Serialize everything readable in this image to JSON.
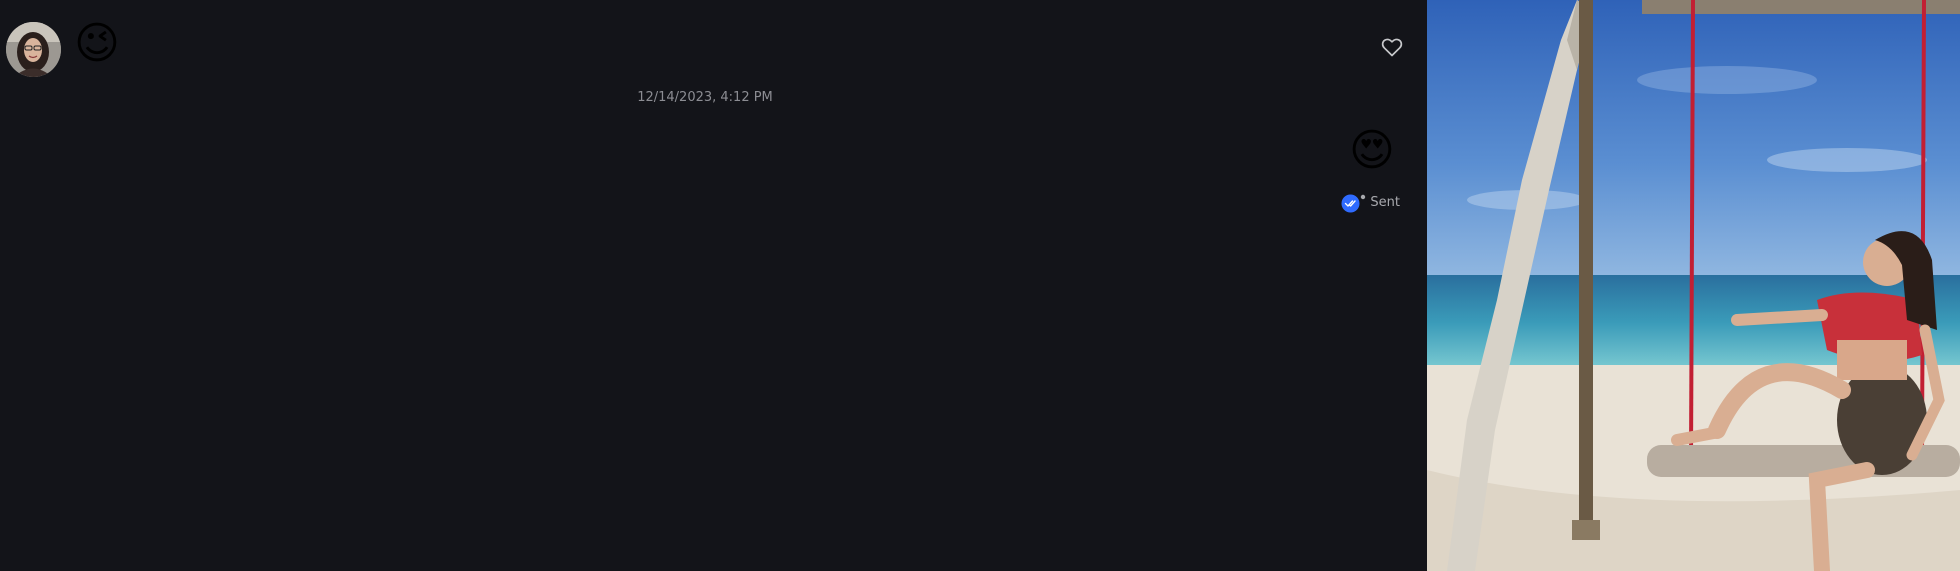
{
  "conversation": {
    "incoming_message": {
      "emoji": "😉"
    },
    "timestamp": "12/14/2023, 4:12 PM",
    "outgoing_message": {
      "emoji": "😍",
      "status": "Sent"
    }
  },
  "icons": {
    "avatar": "avatar",
    "like": "heart-outline-icon",
    "read_receipt": "double-check-icon"
  },
  "colors": {
    "background": "#131419",
    "timestamp_text": "#8c8d93",
    "status_text": "#a8a9ae",
    "receipt_badge": "#2f6bff"
  }
}
